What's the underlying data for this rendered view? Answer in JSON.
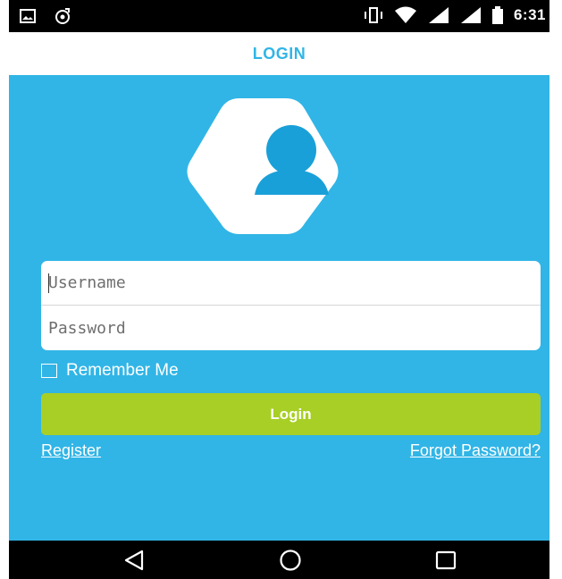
{
  "status_bar": {
    "time": "6:31",
    "left_icons": [
      "picture-icon",
      "media-icon"
    ],
    "right_icons": [
      "vibrate-icon",
      "wifi-icon",
      "signal-icon",
      "signal-icon",
      "battery-icon"
    ]
  },
  "header": {
    "title": "LOGIN"
  },
  "form": {
    "username_placeholder": "Username",
    "password_placeholder": "Password",
    "remember_label": "Remember Me",
    "login_label": "Login"
  },
  "links": {
    "register": "Register",
    "forgot_password": "Forgot Password?"
  },
  "colors": {
    "background": "#31b5e6",
    "login_button": "#a8cf25",
    "avatar": "#1aa0d8"
  },
  "nav_bar": {
    "icons": [
      "back-icon",
      "home-icon",
      "recent-apps-icon"
    ]
  }
}
